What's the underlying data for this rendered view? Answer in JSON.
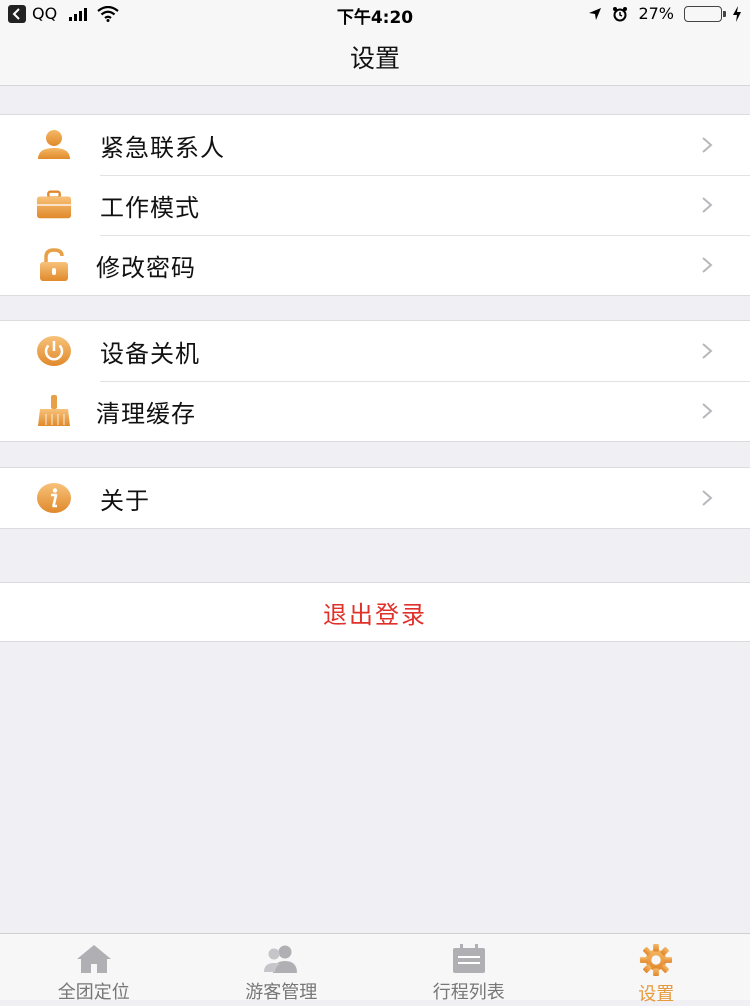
{
  "status_bar": {
    "carrier": "QQ",
    "time": "下午4:20",
    "battery": "27%",
    "battery_level": 0.27
  },
  "header": {
    "title": "设置"
  },
  "groups": [
    {
      "items": [
        {
          "label": "紧急联系人",
          "icon": "contact-person-icon"
        },
        {
          "label": "工作模式",
          "icon": "briefcase-icon"
        },
        {
          "label": "修改密码",
          "icon": "lock-icon"
        }
      ]
    },
    {
      "items": [
        {
          "label": "设备关机",
          "icon": "power-icon"
        },
        {
          "label": "清理缓存",
          "icon": "broom-icon"
        }
      ]
    },
    {
      "items": [
        {
          "label": "关于",
          "icon": "info-icon"
        }
      ]
    }
  ],
  "logout_label": "退出登录",
  "tabs": [
    {
      "label": "全团定位",
      "icon": "home-icon"
    },
    {
      "label": "游客管理",
      "icon": "users-icon"
    },
    {
      "label": "行程列表",
      "icon": "calendar-icon"
    },
    {
      "label": "设置",
      "icon": "gear-icon",
      "active": true
    }
  ],
  "colors": {
    "accent": "#e79a3b",
    "danger": "#e0302a",
    "background": "#efeff4"
  }
}
